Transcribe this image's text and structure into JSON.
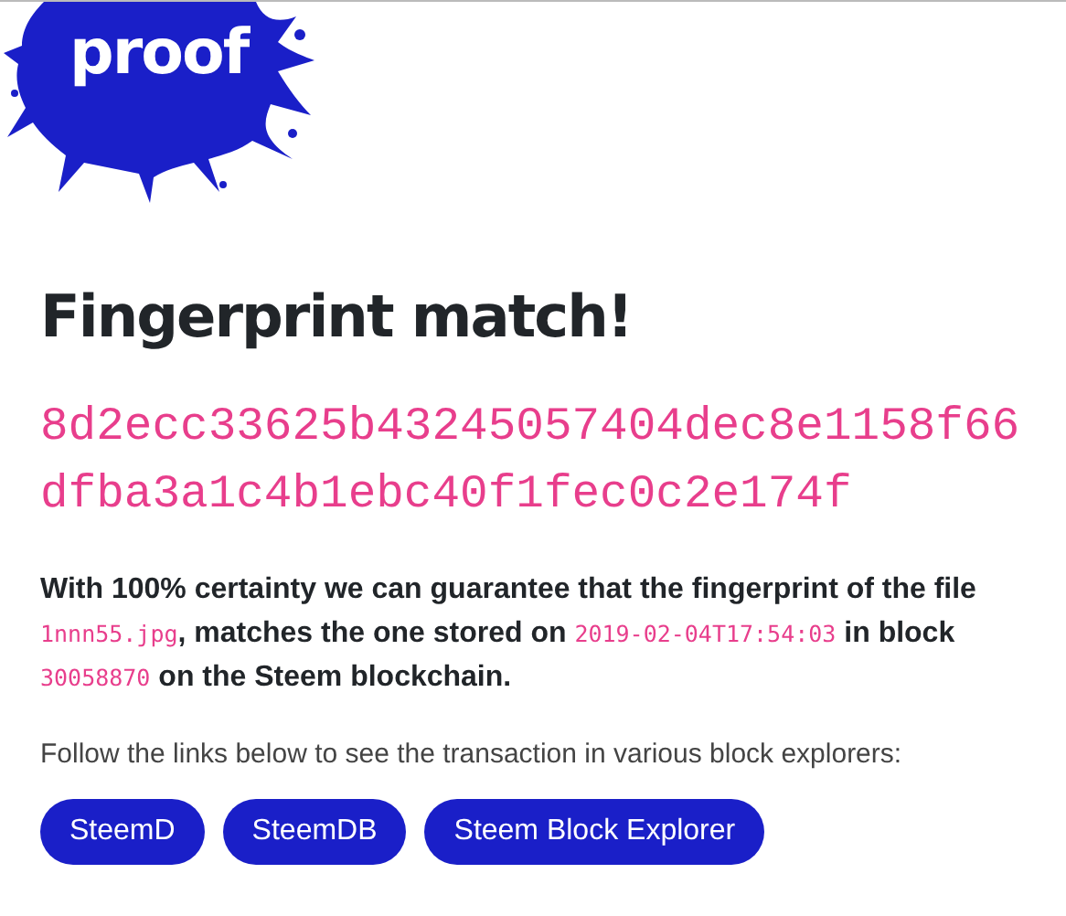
{
  "logo": {
    "text": "proof"
  },
  "heading": "Fingerprint match!",
  "fingerprint_lines": [
    "8d2ecc33625b43245057404dec8e1158f66",
    "dfba3a1c4b1ebc40f1fec0c2e174f"
  ],
  "statement": [
    {
      "kind": "text",
      "text": "With 100% certainty we can guarantee that the fingerprint of the file "
    },
    {
      "kind": "code",
      "text": "1nnn55.jpg"
    },
    {
      "kind": "text",
      "text": ", matches the one stored on "
    },
    {
      "kind": "code",
      "text": "2019-02-04T17:54:03"
    },
    {
      "kind": "text",
      "text": " in block "
    },
    {
      "kind": "code",
      "text": "30058870"
    },
    {
      "kind": "text",
      "text": " on the Steem blockchain."
    }
  ],
  "explorers_intro": "Follow the links below to see the transaction in various block explorers:",
  "explorer_links": [
    "SteemD",
    "SteemDB",
    "Steem Block Explorer"
  ]
}
